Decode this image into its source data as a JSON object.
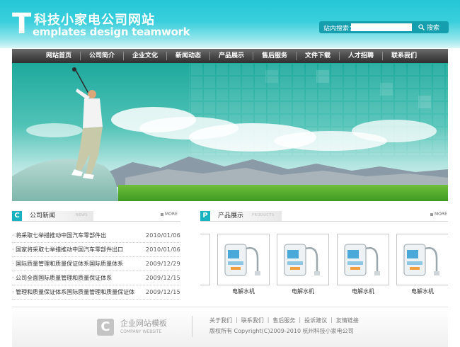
{
  "logo": {
    "big_letter": "T",
    "title_cn": "科技小家电公司网站",
    "subtitle_en": "emplates design teamwork"
  },
  "search": {
    "label": "站内搜索：",
    "value": "",
    "button_label": "搜索"
  },
  "nav": {
    "items": [
      "网站首页",
      "公司简介",
      "企业文化",
      "新闻动态",
      "产品展示",
      "售后服务",
      "文件下载",
      "人才招聘",
      "联系我们"
    ]
  },
  "news": {
    "icon_letter": "C",
    "title": "公司新闻",
    "tag": "NEWS",
    "more_label": "MORE",
    "items": [
      {
        "title": "将采取七举措推动中国汽车零部件出",
        "date": "2010/01/06"
      },
      {
        "title": "国家将采取七举措推动中国汽车零部件出口",
        "date": "2010/01/06"
      },
      {
        "title": "国际质量管理和质量保证体系国际质量体系",
        "date": "2009/12/29"
      },
      {
        "title": "公司全面国际质量管理和质量保证体系",
        "date": "2009/12/15"
      },
      {
        "title": "管理和质量保证体系国际质量管理和质量保证体",
        "date": "2009/12/15"
      }
    ]
  },
  "products": {
    "icon_letter": "P",
    "title": "产品展示",
    "tag": "PRODUCTS",
    "more_label": "MORE",
    "items": [
      {
        "name": ""
      },
      {
        "name": "电解水机"
      },
      {
        "name": "电解水机"
      },
      {
        "name": "电解水机"
      },
      {
        "name": "电解水机"
      }
    ]
  },
  "footer": {
    "logo_letter": "C",
    "logo_cn": "企业网站模板",
    "logo_en": "COMPANY WEBSITE",
    "links": [
      "关于我们",
      "联系我们",
      "售后服务",
      "投诉建议",
      "友情链接"
    ],
    "copyright": "版权所有  Copyright(C)2009-2010 杭州科技小家电公司"
  },
  "colors": {
    "accent": "#19b3bf",
    "nav_bg": "#3d3d3d",
    "header_bg": "#2cc8d8"
  },
  "icons": [
    "search-icon",
    "golfer-photo",
    "water-ionizer-photo"
  ]
}
